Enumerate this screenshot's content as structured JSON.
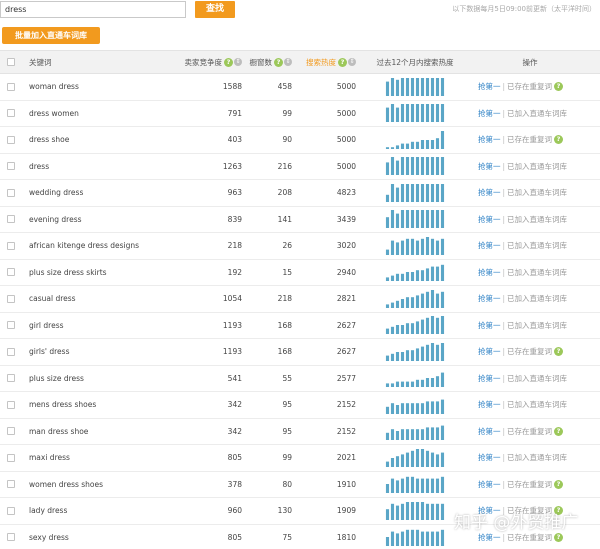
{
  "search": {
    "value": "dress",
    "button_label": "查找"
  },
  "update_note": "以下数据每月5日09:00前更新（太平洋时间）",
  "batch_button_label": "批量加入直通车词库",
  "columns": {
    "keyword": "关键词",
    "competition": "卖家竞争度",
    "window": "橱窗数",
    "hot": "搜索热度",
    "trend": "过去12个月内搜索热度",
    "ops": "操作"
  },
  "ops_labels": {
    "rank": "抢第一",
    "in_lexicon": "已加入直通车词库",
    "in_recommended": "已存在重复词"
  },
  "colors": {
    "accent": "#f29a1e",
    "bar": "#5aa6c7",
    "link": "#2a7fc4",
    "help": "#9cc85a"
  },
  "rows": [
    {
      "keyword": "woman dress",
      "competition": "1588",
      "window": "458",
      "hot": "5000",
      "trend": [
        8,
        10,
        9,
        10,
        10,
        10,
        10,
        10,
        10,
        10,
        10,
        10
      ],
      "state": "已存在重复词",
      "help": true
    },
    {
      "keyword": "dress women",
      "competition": "791",
      "window": "99",
      "hot": "5000",
      "trend": [
        8,
        10,
        8,
        10,
        10,
        10,
        10,
        10,
        10,
        10,
        10,
        10
      ],
      "state": "已加入直通车词库",
      "help": false
    },
    {
      "keyword": "dress shoe",
      "competition": "403",
      "window": "90",
      "hot": "5000",
      "trend": [
        1,
        1,
        2,
        3,
        3,
        4,
        4,
        5,
        5,
        5,
        6,
        10
      ],
      "state": "已存在重复词",
      "help": true
    },
    {
      "keyword": "dress",
      "competition": "1263",
      "window": "216",
      "hot": "5000",
      "trend": [
        7,
        10,
        8,
        10,
        10,
        10,
        10,
        10,
        10,
        10,
        10,
        10
      ],
      "state": "已加入直通车词库",
      "help": false
    },
    {
      "keyword": "wedding dress",
      "competition": "963",
      "window": "208",
      "hot": "4823",
      "trend": [
        4,
        10,
        8,
        10,
        10,
        10,
        10,
        10,
        10,
        10,
        10,
        10
      ],
      "state": "已加入直通车词库",
      "help": false
    },
    {
      "keyword": "evening dress",
      "competition": "839",
      "window": "141",
      "hot": "3439",
      "trend": [
        6,
        10,
        8,
        10,
        10,
        10,
        10,
        10,
        10,
        10,
        10,
        10
      ],
      "state": "已加入直通车词库",
      "help": false
    },
    {
      "keyword": "african kitenge dress designs",
      "competition": "218",
      "window": "26",
      "hot": "3020",
      "trend": [
        3,
        8,
        7,
        8,
        9,
        9,
        8,
        9,
        10,
        9,
        8,
        9
      ],
      "state": "已加入直通车词库",
      "help": false
    },
    {
      "keyword": "plus size dress skirts",
      "competition": "192",
      "window": "15",
      "hot": "2940",
      "trend": [
        2,
        3,
        4,
        4,
        5,
        5,
        6,
        6,
        7,
        8,
        8,
        9
      ],
      "state": "已加入直通车词库",
      "help": false
    },
    {
      "keyword": "casual dress",
      "competition": "1054",
      "window": "218",
      "hot": "2821",
      "trend": [
        2,
        3,
        4,
        5,
        6,
        6,
        7,
        8,
        9,
        10,
        8,
        9
      ],
      "state": "已加入直通车词库",
      "help": false
    },
    {
      "keyword": "girl dress",
      "competition": "1193",
      "window": "168",
      "hot": "2627",
      "trend": [
        3,
        4,
        5,
        5,
        6,
        6,
        7,
        8,
        9,
        10,
        9,
        10
      ],
      "state": "已加入直通车词库",
      "help": false
    },
    {
      "keyword": "girls' dress",
      "competition": "1193",
      "window": "168",
      "hot": "2627",
      "trend": [
        3,
        4,
        5,
        5,
        6,
        6,
        7,
        8,
        9,
        10,
        9,
        10
      ],
      "state": "已存在重复词",
      "help": true
    },
    {
      "keyword": "plus size dress",
      "competition": "541",
      "window": "55",
      "hot": "2577",
      "trend": [
        2,
        2,
        3,
        3,
        3,
        3,
        4,
        4,
        5,
        5,
        6,
        8
      ],
      "state": "已加入直通车词库",
      "help": false
    },
    {
      "keyword": "mens dress shoes",
      "competition": "342",
      "window": "95",
      "hot": "2152",
      "trend": [
        4,
        6,
        5,
        6,
        6,
        6,
        6,
        6,
        7,
        7,
        7,
        8
      ],
      "state": "已加入直通车词库",
      "help": false
    },
    {
      "keyword": "man dress shoe",
      "competition": "342",
      "window": "95",
      "hot": "2152",
      "trend": [
        4,
        6,
        5,
        6,
        6,
        6,
        6,
        6,
        7,
        7,
        7,
        8
      ],
      "state": "已存在重复词",
      "help": true
    },
    {
      "keyword": "maxi dress",
      "competition": "805",
      "window": "99",
      "hot": "2021",
      "trend": [
        3,
        5,
        6,
        7,
        8,
        9,
        10,
        10,
        9,
        8,
        7,
        8
      ],
      "state": "已加入直通车词库",
      "help": false
    },
    {
      "keyword": "women dress shoes",
      "competition": "378",
      "window": "80",
      "hot": "1910",
      "trend": [
        5,
        8,
        7,
        8,
        9,
        9,
        8,
        8,
        8,
        8,
        8,
        9
      ],
      "state": "已存在重复词",
      "help": true
    },
    {
      "keyword": "lady dress",
      "competition": "960",
      "window": "130",
      "hot": "1909",
      "trend": [
        6,
        9,
        8,
        9,
        10,
        10,
        10,
        10,
        9,
        9,
        9,
        9
      ],
      "state": "已存在重复词",
      "help": true
    },
    {
      "keyword": "sexy dress",
      "competition": "805",
      "window": "75",
      "hot": "1810",
      "trend": [
        5,
        8,
        7,
        8,
        9,
        9,
        9,
        8,
        8,
        8,
        8,
        9
      ],
      "state": "已存在重复词",
      "help": true
    }
  ],
  "watermark": "知乎 @外贸推广"
}
